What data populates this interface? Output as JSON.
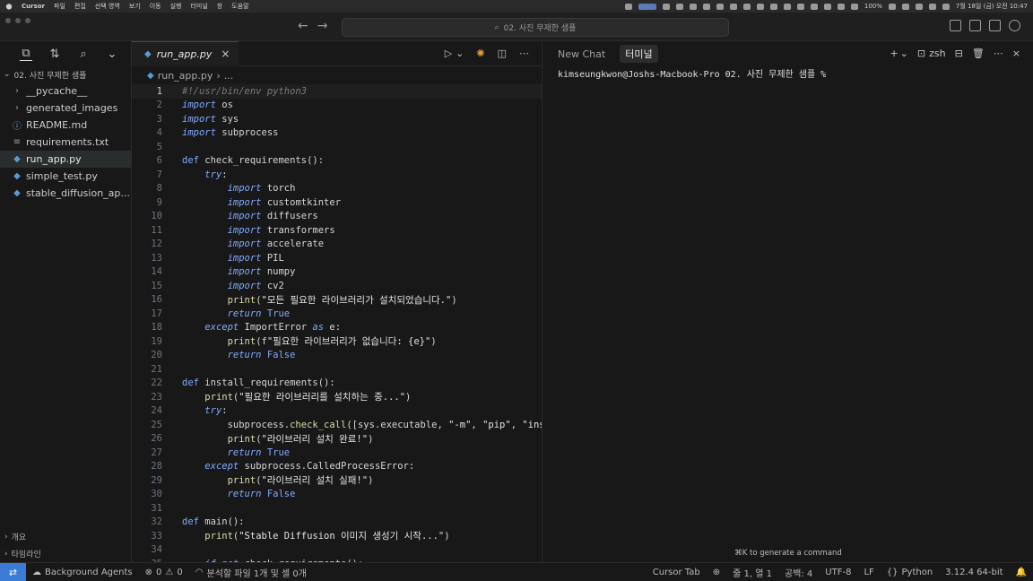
{
  "menubar": {
    "app": "Cursor",
    "items": [
      "파일",
      "편집",
      "선택 영역",
      "보기",
      "이동",
      "실행",
      "터미널",
      "창",
      "도움말"
    ],
    "battery": "100%",
    "datetime": "7월 18일 (금) 오전 10:47"
  },
  "titlebar": {
    "search_text": "02. 사진 무제한 샘플"
  },
  "sidebar": {
    "folder": "02. 사진 무제한 샘플",
    "items": [
      {
        "label": "__pycache__",
        "type": "folder"
      },
      {
        "label": "generated_images",
        "type": "folder"
      },
      {
        "label": "README.md",
        "type": "info"
      },
      {
        "label": "requirements.txt",
        "type": "text"
      },
      {
        "label": "run_app.py",
        "type": "py",
        "selected": true
      },
      {
        "label": "simple_test.py",
        "type": "py"
      },
      {
        "label": "stable_diffusion_ap...",
        "type": "py"
      }
    ],
    "bottom": [
      "개요",
      "타임라인"
    ]
  },
  "editor": {
    "tab_label": "run_app.py",
    "breadcrumb_file": "run_app.py",
    "breadcrumb_rest": "...",
    "lines": [
      "#!/usr/bin/env python3",
      "import os",
      "import sys",
      "import subprocess",
      "",
      "def check_requirements():",
      "    try:",
      "        import torch",
      "        import customtkinter",
      "        import diffusers",
      "        import transformers",
      "        import accelerate",
      "        import PIL",
      "        import numpy",
      "        import cv2",
      "        print(\"모든 필요한 라이브러리가 설치되었습니다.\")",
      "        return True",
      "    except ImportError as e:",
      "        print(f\"필요한 라이브러리가 없습니다: {e}\")",
      "        return False",
      "",
      "def install_requirements():",
      "    print(\"필요한 라이브러리를 설치하는 중...\")",
      "    try:",
      "        subprocess.check_call([sys.executable, \"-m\", \"pip\", \"ins",
      "        print(\"라이브러리 설치 완료!\")",
      "        return True",
      "    except subprocess.CalledProcessError:",
      "        print(\"라이브러리 설치 실패!\")",
      "        return False",
      "",
      "def main():",
      "    print(\"Stable Diffusion 이미지 생성기 시작...\")",
      "",
      "    if not check_requirements():"
    ]
  },
  "panel": {
    "tabs": [
      "New Chat",
      "터미널"
    ],
    "shell": "zsh",
    "prompt": "kimseungkwon@Joshs-Macbook-Pro 02. 사진 무제한 샘플 %",
    "hint": "⌘K to generate a command"
  },
  "statusbar": {
    "background_agents": "Background Agents",
    "errors": "0",
    "warnings": "0",
    "analysis": "분석할 파일 1개 및 셀 0개",
    "cursor_tab": "Cursor Tab",
    "position": "줄 1, 열 1",
    "spaces": "공백: 4",
    "encoding": "UTF-8",
    "eol": "LF",
    "language": "Python",
    "interpreter": "3.12.4 64-bit"
  }
}
